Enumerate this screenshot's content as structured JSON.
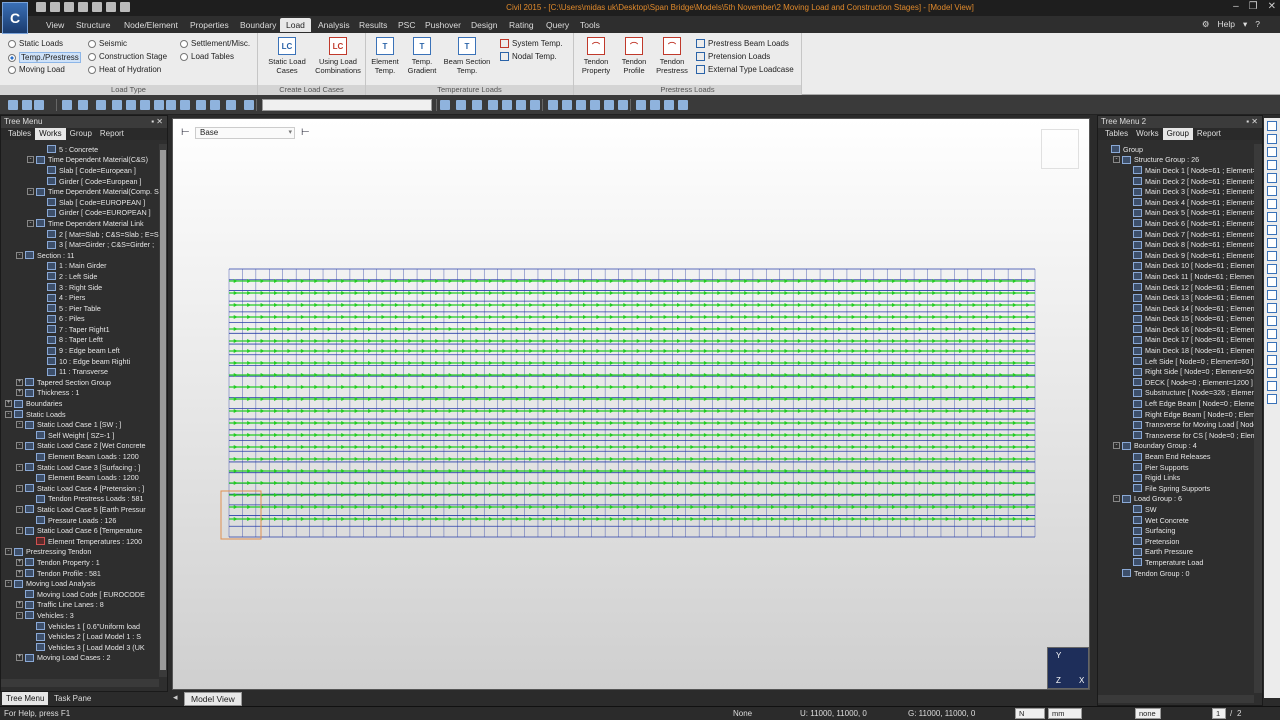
{
  "app": {
    "logo_text": "C",
    "title": "Civil 2015 - [C:\\Users\\midas uk\\Desktop\\Span Bridge\\Models\\5th November\\2 Moving Load and Construction Stages] - [Model View]"
  },
  "menu": {
    "items": [
      "View",
      "Structure",
      "Node/Element",
      "Properties",
      "Boundary",
      "Load",
      "Analysis",
      "Results",
      "PSC",
      "Pushover",
      "Design",
      "Rating",
      "Query",
      "Tools"
    ],
    "active": "Load",
    "help": "Help"
  },
  "ribbon": {
    "load_type": {
      "caption": "Load Type",
      "options": [
        "Static Loads",
        "Temp./Prestress",
        "Moving Load",
        "Seismic",
        "Construction Stage",
        "Heat of Hydration",
        "Settlement/Misc.",
        "Load Tables"
      ],
      "selected": "Temp./Prestress"
    },
    "create_load_cases": {
      "caption": "Create Load Cases",
      "buttons": [
        {
          "label": "Static Load Cases",
          "icon": "LC"
        },
        {
          "label": "Using Load Combinations",
          "icon": "LC"
        }
      ]
    },
    "temperature_loads": {
      "caption": "Temperature Loads",
      "buttons": [
        "Element Temp.",
        "Temp. Gradient",
        "Beam Section Temp."
      ],
      "small": [
        "System Temp.",
        "Nodal Temp."
      ]
    },
    "prestress_loads": {
      "caption": "Prestress Loads",
      "buttons": [
        "Tendon Property",
        "Tendon Profile",
        "Tendon Prestress"
      ],
      "small": [
        "Prestress Beam Loads",
        "Pretension Loads",
        "External Type Loadcase"
      ]
    }
  },
  "tree_menu": {
    "title": "Tree Menu",
    "tabs": [
      "Tables",
      "Works",
      "Group",
      "Report"
    ],
    "active_tab": "Works",
    "rows": [
      {
        "indent": 3,
        "toggle": "",
        "icon": "blue",
        "text": "5 : Concrete"
      },
      {
        "indent": 2,
        "toggle": "-",
        "icon": "blue",
        "text": "Time Dependent Material(C&S)"
      },
      {
        "indent": 3,
        "toggle": "",
        "icon": "blue",
        "text": "Slab [ Code=European ]"
      },
      {
        "indent": 3,
        "toggle": "",
        "icon": "blue",
        "text": "Girder [ Code=European ]"
      },
      {
        "indent": 2,
        "toggle": "-",
        "icon": "blue",
        "text": "Time Dependent Material(Comp. S"
      },
      {
        "indent": 3,
        "toggle": "",
        "icon": "blue",
        "text": "Slab [ Code=EUROPEAN ]"
      },
      {
        "indent": 3,
        "toggle": "",
        "icon": "blue",
        "text": "Girder [ Code=EUROPEAN ]"
      },
      {
        "indent": 2,
        "toggle": "-",
        "icon": "blue",
        "text": "Time Dependent Material Link"
      },
      {
        "indent": 3,
        "toggle": "",
        "icon": "blue",
        "text": "2 [ Mat=Slab ; C&S=Slab ; E=S"
      },
      {
        "indent": 3,
        "toggle": "",
        "icon": "blue",
        "text": "3 [ Mat=Girder ; C&S=Girder ;"
      },
      {
        "indent": 1,
        "toggle": "-",
        "icon": "blue",
        "text": "Section : 11"
      },
      {
        "indent": 3,
        "toggle": "",
        "icon": "blue",
        "text": "1 : Main Girder"
      },
      {
        "indent": 3,
        "toggle": "",
        "icon": "blue",
        "text": "2 : Left Side"
      },
      {
        "indent": 3,
        "toggle": "",
        "icon": "blue",
        "text": "3 : Right Side"
      },
      {
        "indent": 3,
        "toggle": "",
        "icon": "blue",
        "text": "4 : Piers"
      },
      {
        "indent": 3,
        "toggle": "",
        "icon": "blue",
        "text": "5 : Pier Table"
      },
      {
        "indent": 3,
        "toggle": "",
        "icon": "blue",
        "text": "6 : Piles"
      },
      {
        "indent": 3,
        "toggle": "",
        "icon": "blue",
        "text": "7 : Taper Right1"
      },
      {
        "indent": 3,
        "toggle": "",
        "icon": "blue",
        "text": "8 : Taper Leftt"
      },
      {
        "indent": 3,
        "toggle": "",
        "icon": "blue",
        "text": "9 : Edge beam Left"
      },
      {
        "indent": 3,
        "toggle": "",
        "icon": "blue",
        "text": "10 : Edge beam Righti"
      },
      {
        "indent": 3,
        "toggle": "",
        "icon": "blue",
        "text": "11 : Transverse"
      },
      {
        "indent": 1,
        "toggle": "+",
        "icon": "blue",
        "text": "Tapered Section Group"
      },
      {
        "indent": 1,
        "toggle": "+",
        "icon": "blue",
        "text": "Thickness : 1"
      },
      {
        "indent": 0,
        "toggle": "+",
        "icon": "blue",
        "text": "Boundaries"
      },
      {
        "indent": 0,
        "toggle": "-",
        "icon": "blue",
        "text": "Static Loads"
      },
      {
        "indent": 1,
        "toggle": "-",
        "icon": "blue",
        "text": "Static Load Case 1 [SW ; ]"
      },
      {
        "indent": 2,
        "toggle": "",
        "icon": "blue",
        "text": "Self Weight [ SZ=-1 ]"
      },
      {
        "indent": 1,
        "toggle": "-",
        "icon": "blue",
        "text": "Static Load Case 2 [Wet Concrete"
      },
      {
        "indent": 2,
        "toggle": "",
        "icon": "blue",
        "text": "Element Beam Loads : 1200"
      },
      {
        "indent": 1,
        "toggle": "-",
        "icon": "blue",
        "text": "Static Load Case 3 [Surfacing ; ]"
      },
      {
        "indent": 2,
        "toggle": "",
        "icon": "blue",
        "text": "Element Beam Loads : 1200"
      },
      {
        "indent": 1,
        "toggle": "-",
        "icon": "blue",
        "text": "Static Load Case 4 [Pretension ; ]"
      },
      {
        "indent": 2,
        "toggle": "",
        "icon": "blue",
        "text": "Tendon Prestress Loads : 581"
      },
      {
        "indent": 1,
        "toggle": "-",
        "icon": "blue",
        "text": "Static Load Case 5 [Earth Pressur"
      },
      {
        "indent": 2,
        "toggle": "",
        "icon": "blue",
        "text": "Pressure Loads : 126"
      },
      {
        "indent": 1,
        "toggle": "-",
        "icon": "blue",
        "text": "Static Load Case 6 [Temperature"
      },
      {
        "indent": 2,
        "toggle": "",
        "icon": "red",
        "text": "Element Temperatures : 1200"
      },
      {
        "indent": 0,
        "toggle": "-",
        "icon": "blue",
        "text": "Prestressing Tendon"
      },
      {
        "indent": 1,
        "toggle": "+",
        "icon": "blue",
        "text": "Tendon Property : 1"
      },
      {
        "indent": 1,
        "toggle": "+",
        "icon": "blue",
        "text": "Tendon Profile : 581"
      },
      {
        "indent": 0,
        "toggle": "-",
        "icon": "blue",
        "text": "Moving Load Analysis"
      },
      {
        "indent": 1,
        "toggle": "",
        "icon": "blue",
        "text": "Moving Load Code [ EUROCODE"
      },
      {
        "indent": 1,
        "toggle": "+",
        "icon": "blue",
        "text": "Traffic Line Lanes : 8"
      },
      {
        "indent": 1,
        "toggle": "-",
        "icon": "blue",
        "text": "Vehicles : 3"
      },
      {
        "indent": 2,
        "toggle": "",
        "icon": "blue",
        "text": "Vehicles 1 [ 0.6\"Uniform load"
      },
      {
        "indent": 2,
        "toggle": "",
        "icon": "blue",
        "text": "Vehicles 2 [ Load Model 1 : S"
      },
      {
        "indent": 2,
        "toggle": "",
        "icon": "blue",
        "text": "Vehicles 3 [ Load Model 3 (UK"
      },
      {
        "indent": 1,
        "toggle": "+",
        "icon": "blue",
        "text": "Moving Load Cases : 2"
      }
    ],
    "bottom_tabs": [
      "Tree Menu",
      "Task Pane"
    ],
    "active_bottom_tab": "Tree Menu"
  },
  "tree_menu_2": {
    "title": "Tree Menu 2",
    "tabs": [
      "Tables",
      "Works",
      "Group",
      "Report"
    ],
    "active_tab": "Group",
    "rows": [
      {
        "indent": 0,
        "toggle": "",
        "icon": "blue",
        "text": "Group"
      },
      {
        "indent": 1,
        "toggle": "-",
        "icon": "blue",
        "text": "Structure Group : 26"
      },
      {
        "indent": 2,
        "toggle": "",
        "icon": "blue",
        "text": "Main Deck 1 [ Node=61 ; Element=60"
      },
      {
        "indent": 2,
        "toggle": "",
        "icon": "blue",
        "text": "Main Deck 2 [ Node=61 ; Element=60"
      },
      {
        "indent": 2,
        "toggle": "",
        "icon": "blue",
        "text": "Main Deck 3 [ Node=61 ; Element=60"
      },
      {
        "indent": 2,
        "toggle": "",
        "icon": "blue",
        "text": "Main Deck 4 [ Node=61 ; Element=60"
      },
      {
        "indent": 2,
        "toggle": "",
        "icon": "blue",
        "text": "Main Deck 5 [ Node=61 ; Element=60"
      },
      {
        "indent": 2,
        "toggle": "",
        "icon": "blue",
        "text": "Main Deck 6 [ Node=61 ; Element=60"
      },
      {
        "indent": 2,
        "toggle": "",
        "icon": "blue",
        "text": "Main Deck 7 [ Node=61 ; Element=60"
      },
      {
        "indent": 2,
        "toggle": "",
        "icon": "blue",
        "text": "Main Deck 8 [ Node=61 ; Element=60"
      },
      {
        "indent": 2,
        "toggle": "",
        "icon": "blue",
        "text": "Main Deck 9 [ Node=61 ; Element=60"
      },
      {
        "indent": 2,
        "toggle": "",
        "icon": "blue",
        "text": "Main Deck 10 [ Node=61 ; Element=6"
      },
      {
        "indent": 2,
        "toggle": "",
        "icon": "blue",
        "text": "Main Deck 11 [ Node=61 ; Element=6"
      },
      {
        "indent": 2,
        "toggle": "",
        "icon": "blue",
        "text": "Main Deck 12 [ Node=61 ; Element=6"
      },
      {
        "indent": 2,
        "toggle": "",
        "icon": "blue",
        "text": "Main Deck 13 [ Node=61 ; Element=6"
      },
      {
        "indent": 2,
        "toggle": "",
        "icon": "blue",
        "text": "Main Deck 14 [ Node=61 ; Element=6"
      },
      {
        "indent": 2,
        "toggle": "",
        "icon": "blue",
        "text": "Main Deck 15 [ Node=61 ; Element=6"
      },
      {
        "indent": 2,
        "toggle": "",
        "icon": "blue",
        "text": "Main Deck 16 [ Node=61 ; Element=6"
      },
      {
        "indent": 2,
        "toggle": "",
        "icon": "blue",
        "text": "Main Deck 17 [ Node=61 ; Element=6"
      },
      {
        "indent": 2,
        "toggle": "",
        "icon": "blue",
        "text": "Main Deck 18 [ Node=61 ; Element=6"
      },
      {
        "indent": 2,
        "toggle": "",
        "icon": "blue",
        "text": "Left Side [ Node=0 ; Element=60 ]"
      },
      {
        "indent": 2,
        "toggle": "",
        "icon": "blue",
        "text": "Right Side [ Node=0 ; Element=60 ]"
      },
      {
        "indent": 2,
        "toggle": "",
        "icon": "blue",
        "text": "DECK [ Node=0 ; Element=1200 ]"
      },
      {
        "indent": 2,
        "toggle": "",
        "icon": "blue",
        "text": "Substructure [ Node=326 ; Element=3"
      },
      {
        "indent": 2,
        "toggle": "",
        "icon": "blue",
        "text": "Left Edge Beam [ Node=0 ; Element="
      },
      {
        "indent": 2,
        "toggle": "",
        "icon": "blue",
        "text": "Right Edge Beam [ Node=0 ; Element="
      },
      {
        "indent": 2,
        "toggle": "",
        "icon": "blue",
        "text": "Transverse for Moving Load [ Node=2"
      },
      {
        "indent": 2,
        "toggle": "",
        "icon": "blue",
        "text": "Transverse for CS [ Node=0 ; Eleme"
      },
      {
        "indent": 1,
        "toggle": "-",
        "icon": "blue",
        "text": "Boundary Group : 4"
      },
      {
        "indent": 2,
        "toggle": "",
        "icon": "blue",
        "text": "Beam End Releases"
      },
      {
        "indent": 2,
        "toggle": "",
        "icon": "blue",
        "text": "Pier Supports"
      },
      {
        "indent": 2,
        "toggle": "",
        "icon": "blue",
        "text": "Rigid Links"
      },
      {
        "indent": 2,
        "toggle": "",
        "icon": "blue",
        "text": "File Spring Supports"
      },
      {
        "indent": 1,
        "toggle": "-",
        "icon": "blue",
        "text": "Load Group : 6"
      },
      {
        "indent": 2,
        "toggle": "",
        "icon": "blue",
        "text": "SW"
      },
      {
        "indent": 2,
        "toggle": "",
        "icon": "blue",
        "text": "Wet Concrete"
      },
      {
        "indent": 2,
        "toggle": "",
        "icon": "blue",
        "text": "Surfacing"
      },
      {
        "indent": 2,
        "toggle": "",
        "icon": "blue",
        "text": "Pretension"
      },
      {
        "indent": 2,
        "toggle": "",
        "icon": "blue",
        "text": "Earth Pressure"
      },
      {
        "indent": 2,
        "toggle": "",
        "icon": "blue",
        "text": "Temperature Load"
      },
      {
        "indent": 1,
        "toggle": "",
        "icon": "blue",
        "text": "Tendon Group : 0"
      }
    ]
  },
  "canvas": {
    "base_combo": "Base",
    "view_tab": "Model View",
    "axis_labels": [
      "Y",
      "Z",
      "X"
    ],
    "colors": {
      "grid": "#2a3fa8",
      "load_arrows": "#22cc22",
      "highlight": "#e09050"
    }
  },
  "status": {
    "help": "For Help, press F1",
    "none": "None",
    "u_coord": "U: 11000, 11000, 0",
    "g_coord": "G: 11000, 11000, 0",
    "unit_force": "N",
    "unit_length": "mm",
    "filter": "none",
    "page": "1",
    "page_total": "2"
  }
}
